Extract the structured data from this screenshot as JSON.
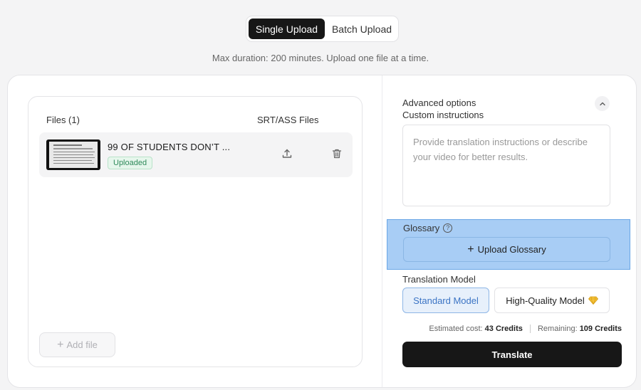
{
  "mode_toggle": {
    "single": "Single Upload",
    "batch": "Batch Upload"
  },
  "hint": "Max duration: 200 minutes. Upload one file at a time.",
  "files": {
    "header_left": "Files (1)",
    "header_right": "SRT/ASS Files",
    "items": [
      {
        "name": "99 OF STUDENTS DON’T ...",
        "status": "Uploaded"
      }
    ],
    "add_file": "Add file"
  },
  "advanced": {
    "title": "Advanced options",
    "custom_instructions_label": "Custom instructions",
    "custom_instructions_placeholder": "Provide translation instructions or describe your video for better results."
  },
  "glossary": {
    "label": "Glossary",
    "upload_label": "Upload Glossary"
  },
  "translation_model": {
    "label": "Translation Model",
    "standard": "Standard Model",
    "high_quality": "High-Quality Model",
    "selected": "Standard Model"
  },
  "cost": {
    "estimated_label": "Estimated cost:",
    "estimated_value": "43 Credits",
    "remaining_label": "Remaining:",
    "remaining_value": "109 Credits"
  },
  "translate_label": "Translate",
  "colors": {
    "accent": "#3b74c4",
    "primary_dark": "#171717",
    "success": "#2f8a5a",
    "highlight": "#a8cdf5"
  }
}
